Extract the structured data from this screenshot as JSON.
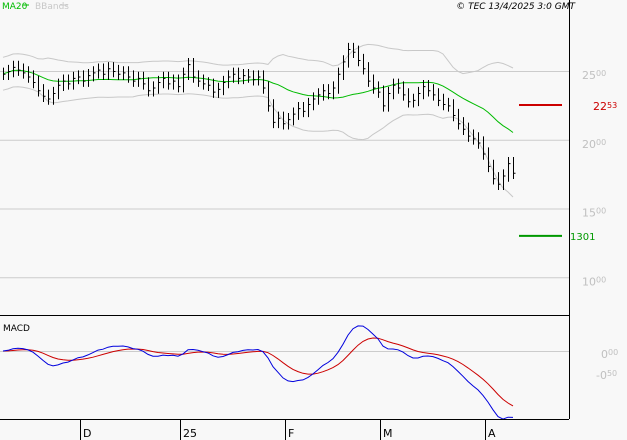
{
  "header": {
    "ma_label": "MA20",
    "bb_label": "BBands",
    "copyright": "© TEC 13/4/2025 3:0 GMT"
  },
  "colors": {
    "ma": "#00bb00",
    "bb": "#c8c8c8",
    "bars": "#000000",
    "resistance": "#cc0000",
    "support": "#009900",
    "macd": "#0000dd",
    "signal": "#cc0000",
    "axis_text": "#c0c0c0"
  },
  "levels": {
    "resistance": {
      "value": 22.53,
      "label_main": "22",
      "label_dec": "53"
    },
    "support": {
      "value": 13.01,
      "label": "1301"
    }
  },
  "macd_panel": {
    "title": "MACD"
  },
  "chart_data": {
    "type": "bar",
    "title": "",
    "price_ticks": [
      {
        "value": 25,
        "main": "25",
        "dec": "00"
      },
      {
        "value": 20,
        "main": "20",
        "dec": "00"
      },
      {
        "value": 15,
        "main": "15",
        "dec": "00"
      },
      {
        "value": 10,
        "main": "10",
        "dec": "00"
      }
    ],
    "macd_ticks": [
      {
        "value": 0,
        "main": "0",
        "dec": "00"
      },
      {
        "value": -0.5,
        "main": "-0",
        "dec": "50"
      }
    ],
    "ylim": [
      6.5,
      28
    ],
    "macd_ylim": [
      -1.4,
      0.75
    ],
    "date_ticks": [
      {
        "index": 15,
        "label": "D"
      },
      {
        "index": 35,
        "label": "25"
      },
      {
        "index": 56,
        "label": "F"
      },
      {
        "index": 75,
        "label": "M"
      },
      {
        "index": 96,
        "label": "A"
      }
    ],
    "closes": [
      24.8,
      25.0,
      25.3,
      25.1,
      24.9,
      24.6,
      24.2,
      23.6,
      23.2,
      23.0,
      23.4,
      24.0,
      24.3,
      24.1,
      24.5,
      24.6,
      24.3,
      24.7,
      24.9,
      25.1,
      24.8,
      25.2,
      25.0,
      24.8,
      24.9,
      24.6,
      24.3,
      24.5,
      24.1,
      23.6,
      23.8,
      24.2,
      24.5,
      24.1,
      24.3,
      23.9,
      24.8,
      25.5,
      24.6,
      24.3,
      24.1,
      24.0,
      23.5,
      23.7,
      24.2,
      24.6,
      24.8,
      24.5,
      24.7,
      24.6,
      24.4,
      24.6,
      23.8,
      22.5,
      21.3,
      21.6,
      21.2,
      21.5,
      21.9,
      22.3,
      22.1,
      22.6,
      23.0,
      23.3,
      23.6,
      23.4,
      23.8,
      24.8,
      25.7,
      26.6,
      26.4,
      25.8,
      25.2,
      24.3,
      23.8,
      23.5,
      22.5,
      23.4,
      24.0,
      23.8,
      23.3,
      22.8,
      22.9,
      23.4,
      23.9,
      23.6,
      23.3,
      22.9,
      22.6,
      22.5,
      21.8,
      21.2,
      20.8,
      20.3,
      20.1,
      19.8,
      19.0,
      18.1,
      17.2,
      16.8,
      17.4,
      18.3,
      17.6
    ],
    "bar_half_range": 0.45,
    "series": [
      {
        "name": "MA20",
        "period": 20
      },
      {
        "name": "BBands",
        "period": 20,
        "stdev": 2
      },
      {
        "name": "MACD",
        "fast": 12,
        "slow": 26,
        "signal": 9
      }
    ]
  }
}
